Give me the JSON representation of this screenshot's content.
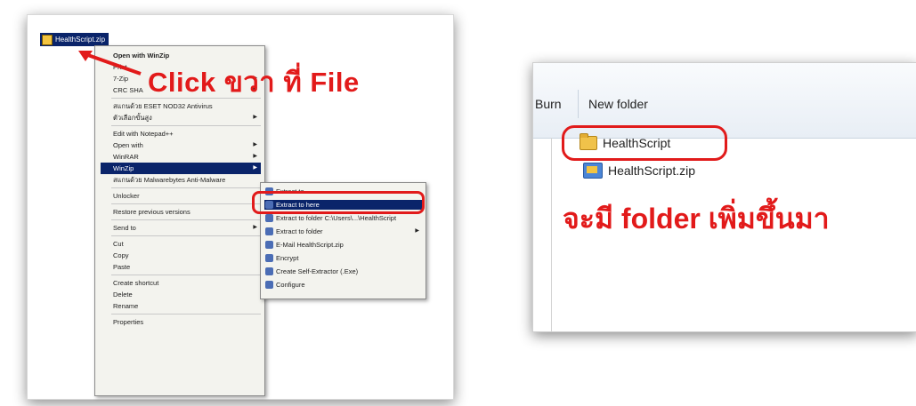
{
  "left": {
    "file_name": "HealthScript.zip",
    "annotation": "Click ขวา ที่  File",
    "context_menu": [
      {
        "label": "Open with WinZip",
        "bold": true
      },
      {
        "label": "Print"
      },
      {
        "label": "7-Zip",
        "arrow": true
      },
      {
        "label": "CRC SHA",
        "arrow": true
      },
      {
        "sep": true
      },
      {
        "label": "สแกนด้วย ESET NOD32 Antivirus"
      },
      {
        "label": "ตัวเลือกขั้นสูง",
        "arrow": true
      },
      {
        "sep": true
      },
      {
        "label": "Edit with Notepad++"
      },
      {
        "label": "Open with",
        "arrow": true
      },
      {
        "label": "WinRAR",
        "arrow": true
      },
      {
        "label": "WinZip",
        "arrow": true,
        "highlight": true
      },
      {
        "label": "สแกนด้วย Malwarebytes Anti-Malware"
      },
      {
        "sep": true
      },
      {
        "label": "Unlocker"
      },
      {
        "sep": true
      },
      {
        "label": "Restore previous versions"
      },
      {
        "sep": true
      },
      {
        "label": "Send to",
        "arrow": true
      },
      {
        "sep": true
      },
      {
        "label": "Cut"
      },
      {
        "label": "Copy"
      },
      {
        "label": "Paste"
      },
      {
        "sep": true
      },
      {
        "label": "Create shortcut"
      },
      {
        "label": "Delete"
      },
      {
        "label": "Rename"
      },
      {
        "sep": true
      },
      {
        "label": "Properties"
      }
    ],
    "submenu": [
      {
        "label": "Extract to..."
      },
      {
        "label": "Extract to here",
        "highlight": true
      },
      {
        "label": "Extract to folder C:\\Users\\...\\HealthScript"
      },
      {
        "label": "Extract to folder",
        "arrow": true
      },
      {
        "label": "E-Mail HealthScript.zip"
      },
      {
        "label": "Encrypt"
      },
      {
        "label": "Create Self-Extractor (.Exe)"
      },
      {
        "label": "Configure"
      }
    ]
  },
  "right": {
    "toolbar": {
      "burn": "Burn",
      "new_folder": "New folder"
    },
    "folder_name": "HealthScript",
    "zip_name": "HealthScript.zip",
    "annotation": "จะมี folder เพิ่มขึ้นมา"
  },
  "colors": {
    "highlight": "#0a246a",
    "annotation_red": "#e21a1a"
  }
}
